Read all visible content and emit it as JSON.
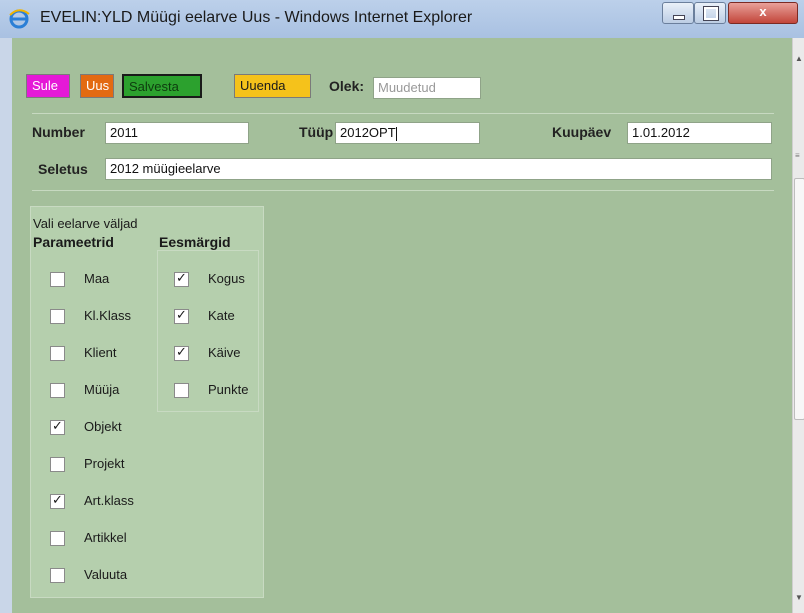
{
  "window": {
    "title": "EVELIN:YLD Müügi eelarve Uus - Windows Internet Explorer",
    "close_label": "x"
  },
  "toolbar": {
    "sule_label": "Sule",
    "uus_label": "Uus",
    "salvesta_label": "Salvesta",
    "uuenda_label": "Uuenda",
    "olek_label": "Olek:",
    "olek_value": "Muudetud"
  },
  "form": {
    "number_label": "Number",
    "number_value": "2011",
    "tyyp_label": "Tüüp",
    "tyyp_value": "2012OPT",
    "kuupaev_label": "Kuupäev",
    "kuupaev_value": "1.01.2012",
    "seletus_label": "Seletus",
    "seletus_value": "2012 müügieelarve"
  },
  "fields_section": {
    "title": "Vali eelarve väljad",
    "parameetrid_header": "Parameetrid",
    "eesmargid_header": "Eesmärgid",
    "parameetrid": [
      {
        "label": "Maa",
        "checked": false
      },
      {
        "label": "Kl.Klass",
        "checked": false
      },
      {
        "label": "Klient",
        "checked": false
      },
      {
        "label": "Müüja",
        "checked": false
      },
      {
        "label": "Objekt",
        "checked": true
      },
      {
        "label": "Projekt",
        "checked": false
      },
      {
        "label": "Art.klass",
        "checked": true
      },
      {
        "label": "Artikkel",
        "checked": false
      },
      {
        "label": "Valuuta",
        "checked": false
      }
    ],
    "eesmargid": [
      {
        "label": "Kogus",
        "checked": true
      },
      {
        "label": "Kate",
        "checked": true
      },
      {
        "label": "Käive",
        "checked": true
      },
      {
        "label": "Punkte",
        "checked": false
      }
    ]
  },
  "colors": {
    "sule": "#e519d7",
    "uus": "#e36a12",
    "salvesta": "#2ca12e",
    "uuenda": "#f5c21b",
    "page_background": "#a4bf9b"
  }
}
